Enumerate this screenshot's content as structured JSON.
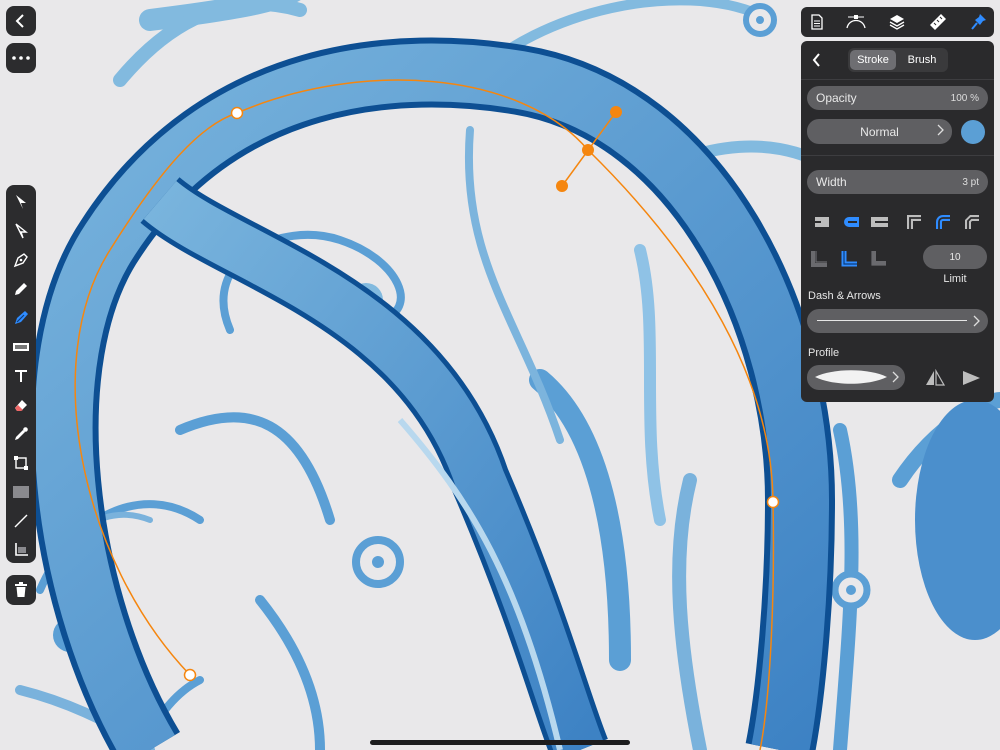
{
  "left_toolbar": {
    "back_icon": "chevron-left-icon",
    "more_icon": "more-icon",
    "tools": [
      "pointer-tool",
      "direct-select-tool",
      "pen-tool",
      "pencil-tool",
      "vector-brush-tool",
      "fill-tool",
      "text-tool",
      "eraser-tool",
      "eyedropper-tool",
      "transform-tool",
      "shape-tool",
      "line-tool",
      "crop-tool"
    ],
    "delete_icon": "trash-icon"
  },
  "top_toolbar": {
    "items": [
      "document-icon",
      "node-icon",
      "layers-icon",
      "ruler-icon",
      "pin-icon"
    ],
    "accent": "#2f8cff"
  },
  "stroke_panel": {
    "tab_stroke": "Stroke",
    "tab_brush": "Brush",
    "opacity_label": "Opacity",
    "opacity_value": "100 %",
    "blend_mode": "Normal",
    "stroke_color": "#5b9fd5",
    "width_label": "Width",
    "width_value": "3 pt",
    "limit_value": "10",
    "limit_label": "Limit",
    "dash_label": "Dash & Arrows",
    "profile_label": "Profile"
  },
  "colors": {
    "panel_bg": "#2a2a2c",
    "accent_blue": "#2f8cff",
    "artwork_blue": "#5b9fd5",
    "artwork_dark": "#0d4f93",
    "node_orange": "#f5860f"
  }
}
